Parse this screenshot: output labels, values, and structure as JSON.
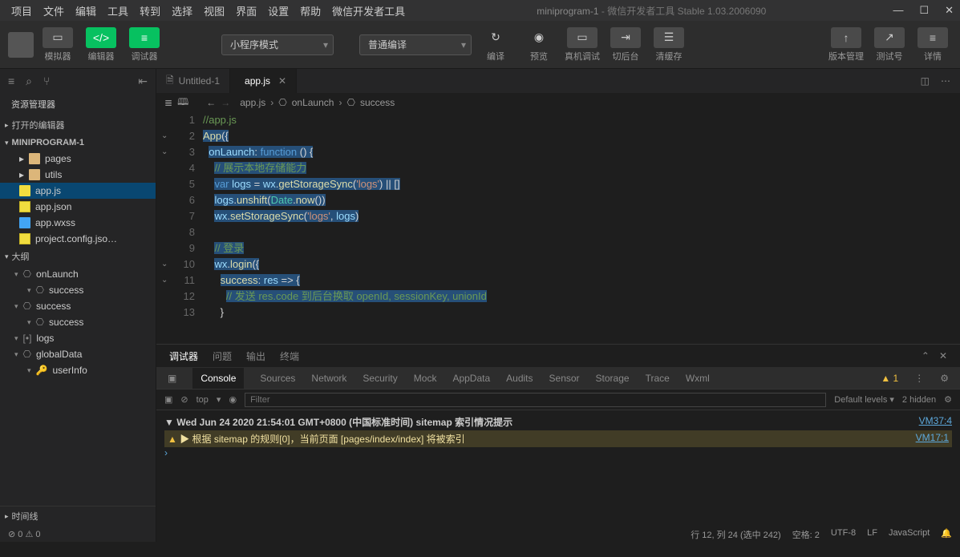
{
  "title": {
    "project": "miniprogram-1",
    "suffix": " - 微信开发者工具 Stable 1.03.2006090"
  },
  "menu": [
    "项目",
    "文件",
    "编辑",
    "工具",
    "转到",
    "选择",
    "视图",
    "界面",
    "设置",
    "帮助",
    "微信开发者工具"
  ],
  "toolbar": {
    "simulator": "模拟器",
    "editor": "编辑器",
    "debugger": "调试器",
    "mode": "小程序模式",
    "compileMode": "普通编译",
    "compile": "编译",
    "preview": "预览",
    "remote": "真机调试",
    "cut": "切后台",
    "clear": "清缓存",
    "version": "版本管理",
    "testnum": "测试号",
    "detail": "详情"
  },
  "explorer": {
    "title": "资源管理器",
    "opened": "打开的编辑器",
    "project": "MINIPROGRAM-1",
    "tree": [
      {
        "icon": "folder",
        "label": "pages"
      },
      {
        "icon": "folder",
        "label": "utils"
      },
      {
        "icon": "js",
        "label": "app.js",
        "sel": true
      },
      {
        "icon": "json",
        "label": "app.json"
      },
      {
        "icon": "wxss",
        "label": "app.wxss"
      },
      {
        "icon": "json",
        "label": "project.config.json",
        "trunc": true
      }
    ],
    "outline": "大纲",
    "outlineTree": [
      {
        "t": "cube",
        "l": "onLaunch",
        "d": 0
      },
      {
        "t": "cube",
        "l": "success",
        "d": 1
      },
      {
        "t": "cube",
        "l": "success",
        "d": 0
      },
      {
        "t": "cube",
        "l": "success",
        "d": 1
      },
      {
        "t": "brack",
        "l": "logs",
        "d": 0
      },
      {
        "t": "cube",
        "l": "globalData",
        "d": 0
      },
      {
        "t": "key",
        "l": "userInfo",
        "d": 1
      }
    ],
    "timeline": "时间线"
  },
  "tabs": [
    {
      "icon": "file",
      "label": "Untitled-1",
      "active": false
    },
    {
      "icon": "js",
      "label": "app.js",
      "active": true,
      "closable": true
    }
  ],
  "breadcrumb": [
    "app.js",
    "onLaunch",
    "success"
  ],
  "code": [
    {
      "n": 1,
      "s": "c-green",
      "t": "//app.js"
    },
    {
      "n": 2,
      "s": "",
      "t": "<span class='c-yel hl'>App</span><span class='c-white hl'>({</span>",
      "fold": "v"
    },
    {
      "n": 3,
      "s": "",
      "t": "  <span class='hl'><span class='c-lblue'>onLaunch</span><span class='c-white'>: </span><span class='c-blue'>function</span><span class='c-white'> () {</span></span>",
      "fold": "v"
    },
    {
      "n": 4,
      "s": "",
      "t": "    <span class='c-green hl'>// 展示本地存储能力</span>"
    },
    {
      "n": 5,
      "s": "",
      "t": "    <span class='hl'><span class='c-blue'>var</span> <span class='c-lblue'>logs</span> <span class='c-white'>=</span> <span class='c-lblue'>wx</span><span class='c-white'>.</span><span class='c-yel'>getStorageSync</span><span class='c-white'>(</span><span class='c-str'>'logs'</span><span class='c-white'>) || []</span></span>"
    },
    {
      "n": 6,
      "s": "",
      "t": "    <span class='hl'><span class='c-lblue'>logs</span><span class='c-white'>.</span><span class='c-yel'>unshift</span><span class='c-white'>(</span><span class='c-class'>Date</span><span class='c-white'>.</span><span class='c-yel'>now</span><span class='c-white'>())</span></span>"
    },
    {
      "n": 7,
      "s": "",
      "t": "    <span class='hl'><span class='c-lblue'>wx</span><span class='c-white'>.</span><span class='c-yel'>setStorageSync</span><span class='c-white'>(</span><span class='c-str'>'logs'</span><span class='c-white'>, </span><span class='c-lblue'>logs</span><span class='c-white'>)</span></span>"
    },
    {
      "n": 8,
      "s": "",
      "t": ""
    },
    {
      "n": 9,
      "s": "",
      "t": "    <span class='c-green hl'>// 登录</span>"
    },
    {
      "n": 10,
      "s": "",
      "t": "    <span class='hl'><span class='c-lblue'>wx</span><span class='c-white'>.</span><span class='c-yel'>login</span><span class='c-white'>({</span></span>",
      "fold": "v"
    },
    {
      "n": 11,
      "s": "",
      "t": "      <span class='hl'><span class='c-yel'>success</span><span class='c-white'>: </span><span class='c-lblue'>res</span><span class='c-white'> => {</span></span>",
      "fold": "v"
    },
    {
      "n": 12,
      "s": "",
      "t": "        <span class='c-green hl'>// 发送 res.code 到后台换取 openId, sessionKey, unionId</span>"
    },
    {
      "n": 13,
      "s": "",
      "t": "      <span class='c-white'>}</span>"
    }
  ],
  "panel": {
    "tabs": [
      "调试器",
      "问题",
      "输出",
      "终端"
    ],
    "devtabs": [
      "Console",
      "Sources",
      "Network",
      "Security",
      "Mock",
      "AppData",
      "Audits",
      "Sensor",
      "Storage",
      "Trace",
      "Wxml"
    ],
    "warncount": "1",
    "filter_top": "top",
    "filter_ph": "Filter",
    "levels": "Default levels",
    "hidden": "2 hidden",
    "log1": "Wed Jun 24 2020 21:54:01 GMT+0800 (中国标准时间) sitemap 索引情况提示",
    "src1": "VM37:4",
    "log2": "▶ 根据 sitemap 的规则[0]，当前页面 [pages/index/index] 将被索引",
    "src2": "VM17:1"
  },
  "status": {
    "errors": "⊘ 0 ⚠ 0",
    "pos": "行 12, 列 24 (选中 242)",
    "spaces": "空格: 2",
    "enc": "UTF-8",
    "eol": "LF",
    "lang": "JavaScript"
  }
}
